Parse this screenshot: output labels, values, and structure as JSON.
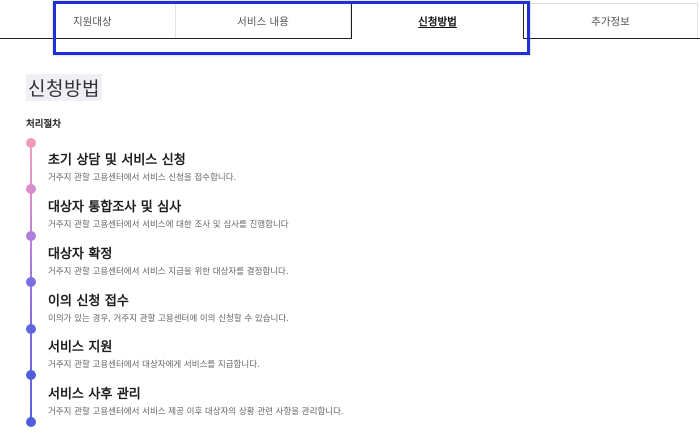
{
  "tabs": [
    {
      "label": "지원대상"
    },
    {
      "label": "서비스 내용"
    },
    {
      "label": "신청방법"
    },
    {
      "label": "추가정보"
    }
  ],
  "page": {
    "title": "신청방법",
    "section_label": "처리절차"
  },
  "steps": [
    {
      "title": "초기 상담 및 서비스 신청",
      "desc": "거주지 관할 고용센터에서 서비스 신청을 접수합니다.",
      "color": "#f29ab9"
    },
    {
      "title": "대상자 통합조사 및 심사",
      "desc": "거주지 관할 고용센터에서 서비스에 대한 조사 및 심사를 진행합니다",
      "color": "#d98ccb"
    },
    {
      "title": "대상자 확정",
      "desc": "거주지 관할 고용센터에서 서비스 지급을 위한 대상자를 결정합니다.",
      "color": "#b07fde"
    },
    {
      "title": "이의 신청 접수",
      "desc": "이의가 있는 경우, 거주지 관할 고용센터에 이의 신청할 수 있습니다.",
      "color": "#7b6ee2"
    },
    {
      "title": "서비스 지원",
      "desc": "거주지 관할 고용센터에서 대상자에게 서비스를 지급합니다.",
      "color": "#6166e0"
    },
    {
      "title": "서비스 사후 관리",
      "desc": "거주지 관할 고용센터에서 서비스 제공 이후 대상자의 상황 관련 사항을 관리합니다.",
      "color": "#4f5fdc"
    }
  ],
  "theme": {
    "highlight_border": "#1f2fd6",
    "text_dark": "#1d1d1d"
  }
}
